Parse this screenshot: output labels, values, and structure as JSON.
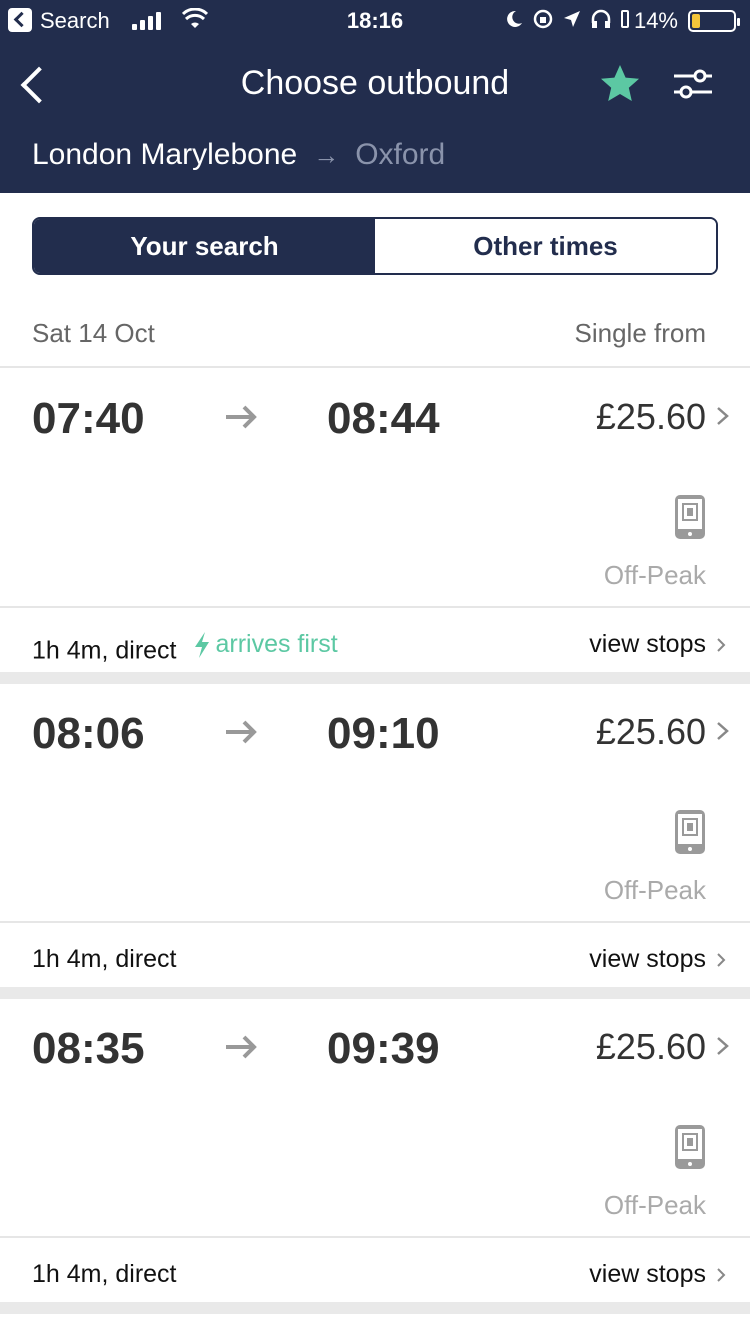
{
  "status_bar": {
    "back_label": "Search",
    "time": "18:16",
    "battery_pct": "14%"
  },
  "header": {
    "title": "Choose outbound",
    "route_from": "London Marylebone",
    "route_to": "Oxford"
  },
  "segment": {
    "active": "Your search",
    "inactive": "Other times"
  },
  "list_header": {
    "date": "Sat 14 Oct",
    "single_from": "Single from"
  },
  "journeys": [
    {
      "depart": "07:40",
      "arrive": "08:44",
      "price": "£25.60",
      "fare": "Off-Peak",
      "duration": "1h 4m, direct",
      "badge": "arrives first",
      "stops_label": "view stops"
    },
    {
      "depart": "08:06",
      "arrive": "09:10",
      "price": "£25.60",
      "fare": "Off-Peak",
      "duration": "1h 4m, direct",
      "badge": "",
      "stops_label": "view stops"
    },
    {
      "depart": "08:35",
      "arrive": "09:39",
      "price": "£25.60",
      "fare": "Off-Peak",
      "duration": "1h 4m, direct",
      "badge": "",
      "stops_label": "view stops"
    }
  ],
  "colors": {
    "navy": "#222d4d",
    "accent_green": "#5cc8a3",
    "muted": "#8a93ab"
  },
  "icons": [
    "back-arrow-icon",
    "star-icon",
    "filter-icon",
    "arrow-right-icon",
    "chevron-right-icon",
    "mobile-ticket-icon",
    "lightning-icon"
  ]
}
